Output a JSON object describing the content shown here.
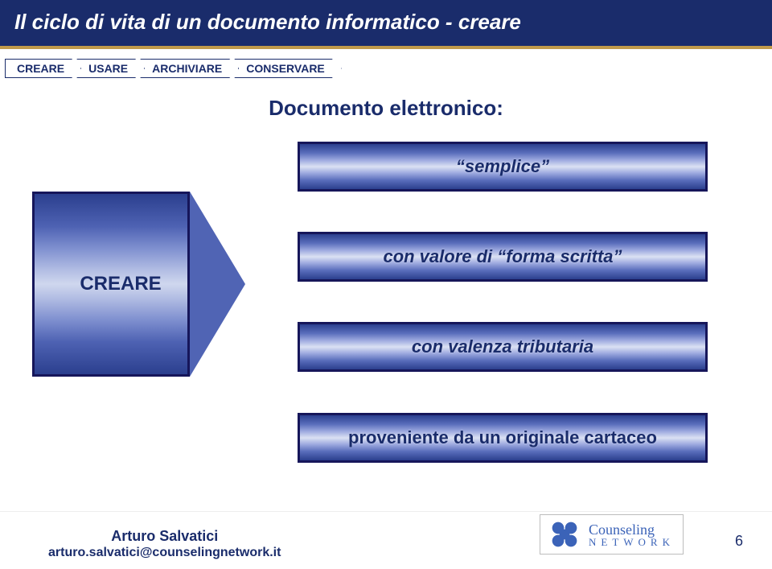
{
  "title": "Il ciclo di vita di un documento informatico - creare",
  "process": {
    "steps": [
      "CREARE",
      "USARE",
      "ARCHIVIARE",
      "CONSERVARE"
    ]
  },
  "heading": "Documento elettronico:",
  "creareLabel": "CREARE",
  "results": {
    "r1": "“semplice”",
    "r2": "con valore di “forma scritta”",
    "r3": "con valenza tributaria",
    "r4": "proveniente da un originale cartaceo"
  },
  "footer": {
    "author": "Arturo Salvatici",
    "email": "arturo.salvatici@counselingnetwork.it",
    "logoLine1": "Counseling",
    "logoLine2": "NETWORK",
    "pageNumber": "6"
  }
}
